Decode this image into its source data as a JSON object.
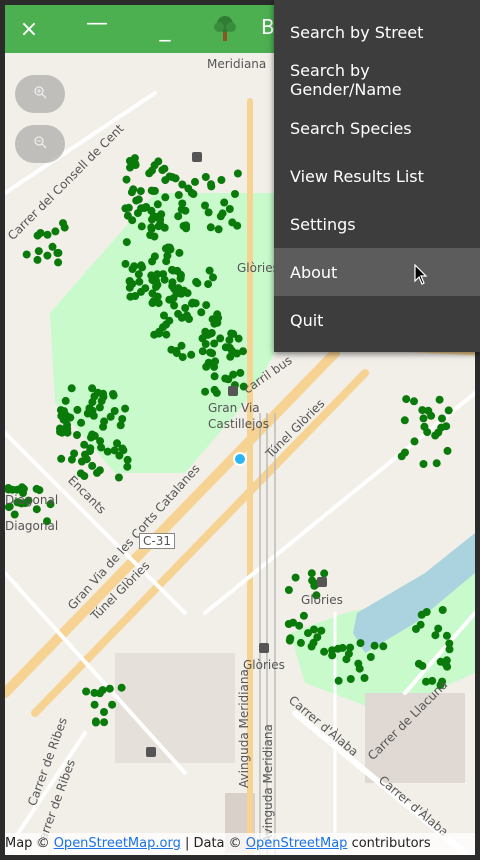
{
  "window": {
    "close_label": "×",
    "minimize_label": "—",
    "restore_label": "_",
    "title_partial": "B",
    "app_icon": "tree-icon"
  },
  "map": {
    "zoom_in_icon": "zoom-in-icon",
    "zoom_out_icon": "zoom-out-icon",
    "street_labels": [
      "Meridiana",
      "Glòries",
      "Gran Via",
      "Castillejos",
      "Túnel Glòries",
      "Túnel Glòries",
      "Gran Via de les Corts Catalanes",
      "C-31",
      "Glòries",
      "Glòries",
      "Avinguda Meridiana",
      "Avinguda Meridiana",
      "Carrer de Ribes",
      "Carrer de Ribes",
      "Carrer d'Àlaba",
      "Carrer d'Àlaba",
      "Carrer de Llacuna",
      "Carrer del Consell de Cent",
      "Diagonal",
      "Diagonal",
      "Encants",
      "carril bus"
    ],
    "attribution": {
      "prefix": "Map © ",
      "osm_link": "OpenStreetMap.org",
      "middle": " | Data © ",
      "osm_link2": "OpenStreetMap",
      "suffix": " contributors"
    }
  },
  "menu": {
    "items": [
      {
        "label": "Search by Street"
      },
      {
        "label": "Search by Gender/Name"
      },
      {
        "label": "Search Species"
      },
      {
        "label": "View Results List"
      },
      {
        "label": "Settings"
      },
      {
        "label": "About"
      },
      {
        "label": "Quit"
      }
    ],
    "hovered_index": 5
  },
  "colors": {
    "topbar": "#4caf50",
    "tree_marker": "#0a7a0a",
    "park": "#c8facc",
    "water": "#aad3df",
    "location_dot": "#29b6f6",
    "menu_bg": "#3d3d3d",
    "menu_hover": "#5c5c5c"
  }
}
